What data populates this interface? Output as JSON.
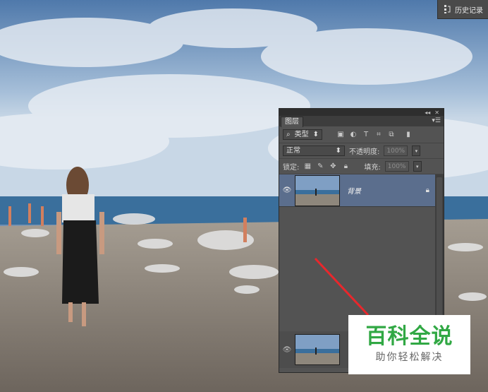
{
  "history_panel": {
    "label": "历史记录",
    "icon": "history-icon"
  },
  "layers_panel": {
    "tab_label": "图层",
    "topbar_icons": [
      "collapse-icon",
      "close-icon"
    ],
    "filter": {
      "selected": "类型",
      "icon": "search-icon"
    },
    "filter_icons": [
      "image-filter-icon",
      "adjustment-filter-icon",
      "text-filter-icon",
      "shape-filter-icon",
      "smart-object-filter-icon",
      "filter-toggle-icon"
    ],
    "blend_mode": "正常",
    "opacity": {
      "label": "不透明度:",
      "value": "100%"
    },
    "lock": {
      "label": "锁定:",
      "icons": [
        "lock-transparent-icon",
        "lock-image-icon",
        "lock-position-icon",
        "lock-all-icon"
      ]
    },
    "fill": {
      "label": "填充:",
      "value": "100%"
    },
    "layers": [
      {
        "name": "背景",
        "visible": true,
        "locked": true,
        "selected": true
      }
    ]
  },
  "watermark": {
    "title": "百科全说",
    "subtitle": "助你轻松解决"
  },
  "colors": {
    "panel_bg": "#535353",
    "selected_layer": "#5b6e8d",
    "watermark_green": "#31a844",
    "arrow_red": "#e8272c"
  }
}
